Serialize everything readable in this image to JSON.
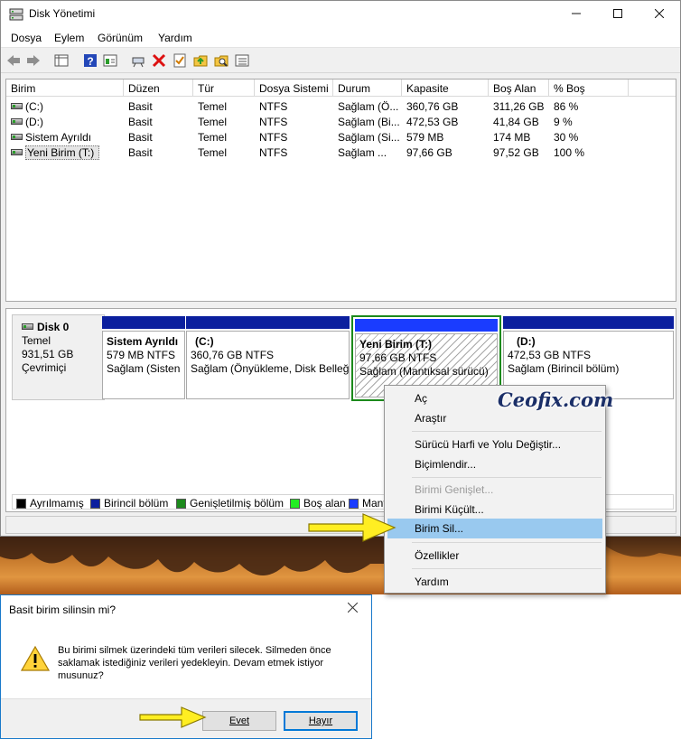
{
  "window": {
    "title": "Disk Yönetimi"
  },
  "menu": [
    "Dosya",
    "Eylem",
    "Görünüm",
    "Yardım"
  ],
  "table": {
    "columns": [
      "Birim",
      "Düzen",
      "Tür",
      "Dosya Sistemi",
      "Durum",
      "Kapasite",
      "Boş Alan",
      "% Boş"
    ],
    "rows": [
      [
        "(C:)",
        "Basit",
        "Temel",
        "NTFS",
        "Sağlam (Ö...",
        "360,76 GB",
        "311,26 GB",
        "86 %"
      ],
      [
        "(D:)",
        "Basit",
        "Temel",
        "NTFS",
        "Sağlam (Bi...",
        "472,53 GB",
        "41,84 GB",
        "9 %"
      ],
      [
        "Sistem Ayrıldı",
        "Basit",
        "Temel",
        "NTFS",
        "Sağlam (Si...",
        "579 MB",
        "174 MB",
        "30 %"
      ],
      [
        "Yeni Birim (T:)",
        "Basit",
        "Temel",
        "NTFS",
        "Sağlam ...",
        "97,66 GB",
        "97,52 GB",
        "100 %"
      ]
    ]
  },
  "disk": {
    "name": "Disk 0",
    "type": "Temel",
    "size": "931,51 GB",
    "status": "Çevrimiçi",
    "partitions": [
      {
        "name": "Sistem Ayrıldı",
        "size": "579 MB NTFS",
        "status": "Sağlam (Sisten"
      },
      {
        "name": "(C:)",
        "size": "360,76 GB NTFS",
        "status": "Sağlam (Önyükleme, Disk Belleğ"
      },
      {
        "name": "Yeni Birim  (T:)",
        "size": "97,66 GB NTFS",
        "status": "Sağlam (Mantıksal sürücü)"
      },
      {
        "name": "(D:)",
        "size": "472,53 GB NTFS",
        "status": "Sağlam (Birincil bölüm)"
      }
    ]
  },
  "legend": [
    {
      "label": "Ayrılmamış",
      "color": "#000000"
    },
    {
      "label": "Birincil bölüm",
      "color": "#0b1f9e"
    },
    {
      "label": "Genişletilmiş bölüm",
      "color": "#1c8a1c"
    },
    {
      "label": "Boş alan",
      "color": "#22ee22"
    },
    {
      "label": "Mant",
      "color": "#1a3cff"
    }
  ],
  "context_menu": {
    "items": [
      {
        "label": "Aç",
        "enabled": true
      },
      {
        "label": "Araştır",
        "enabled": true
      },
      {
        "label": "Sürücü Harfi ve Yolu Değiştir...",
        "enabled": true
      },
      {
        "label": "Biçimlendir...",
        "enabled": true
      },
      {
        "label": "Birimi Genişlet...",
        "enabled": false
      },
      {
        "label": "Birimi Küçült...",
        "enabled": true
      },
      {
        "label": "Birim Sil...",
        "enabled": true,
        "highlighted": true
      },
      {
        "label": "Özellikler",
        "enabled": true
      },
      {
        "label": "Yardım",
        "enabled": true
      }
    ]
  },
  "dialog": {
    "title": "Basit birim silinsin mi?",
    "message": "Bu birimi silmek üzerindeki tüm verileri silecek. Silmeden önce saklamak istediğiniz verileri yedekleyin. Devam etmek istiyor musunuz?",
    "yes_label": "Evet",
    "no_label": "Hayır"
  },
  "watermark": "Ceofix.com",
  "colors": {
    "primary_partition": "#0b1f9e",
    "logical_partition": "#1a3cff",
    "selection_border": "#1c8a1c",
    "menu_highlight": "#99c9ef",
    "annotation_arrow": "#ffee22"
  }
}
